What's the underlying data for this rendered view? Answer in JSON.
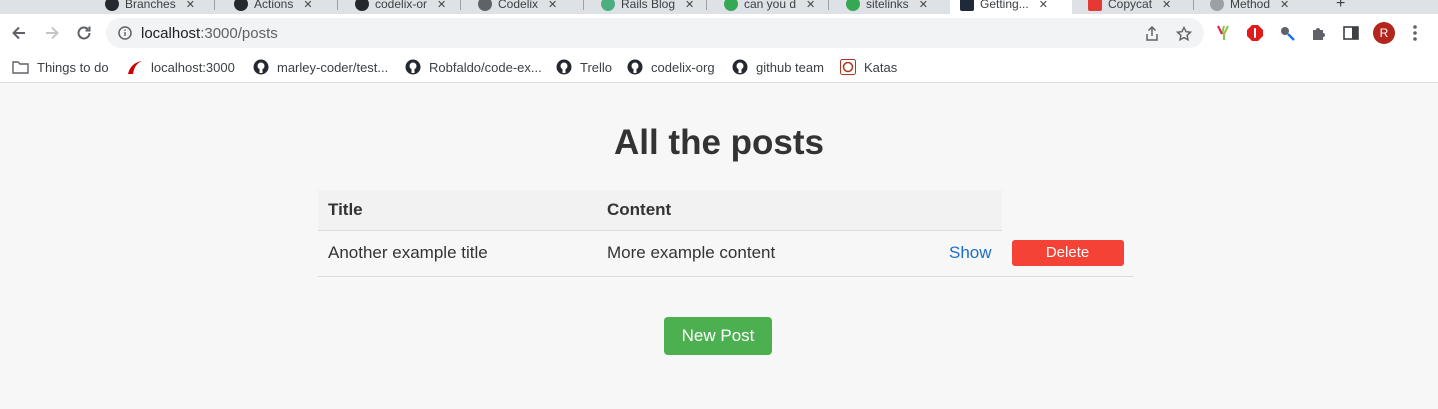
{
  "browser": {
    "tabs": [
      {
        "label": "Branches"
      },
      {
        "label": "Actions"
      },
      {
        "label": "codelix-or"
      },
      {
        "label": "Codelix"
      },
      {
        "label": "Rails Blog"
      },
      {
        "label": "can you d"
      },
      {
        "label": "sitelinks"
      },
      {
        "label": "Getting..."
      },
      {
        "label": "Copycat"
      },
      {
        "label": "Method"
      }
    ],
    "url_host": "localhost",
    "url_path": ":3000/posts",
    "avatar_letter": "R",
    "bookmarks": [
      {
        "label": "Things to do",
        "icon": "folder-icon"
      },
      {
        "label": "localhost:3000",
        "icon": "rails-icon"
      },
      {
        "label": "marley-coder/test...",
        "icon": "github-icon"
      },
      {
        "label": "Robfaldo/code-ex...",
        "icon": "github-icon"
      },
      {
        "label": "Trello",
        "icon": "github-icon"
      },
      {
        "label": "codelix-org",
        "icon": "github-icon"
      },
      {
        "label": "github team",
        "icon": "github-icon"
      },
      {
        "label": "Katas",
        "icon": "codewars-icon"
      }
    ]
  },
  "page": {
    "title": "All the posts",
    "table": {
      "headers": [
        "Title",
        "Content"
      ],
      "rows": [
        {
          "title": "Another example title",
          "content": "More example content",
          "show_label": "Show",
          "delete_label": "Delete"
        }
      ]
    },
    "new_post_label": "New Post"
  },
  "colors": {
    "delete": "#f44336",
    "new_post": "#4caf50",
    "link": "#1a6fc9"
  }
}
